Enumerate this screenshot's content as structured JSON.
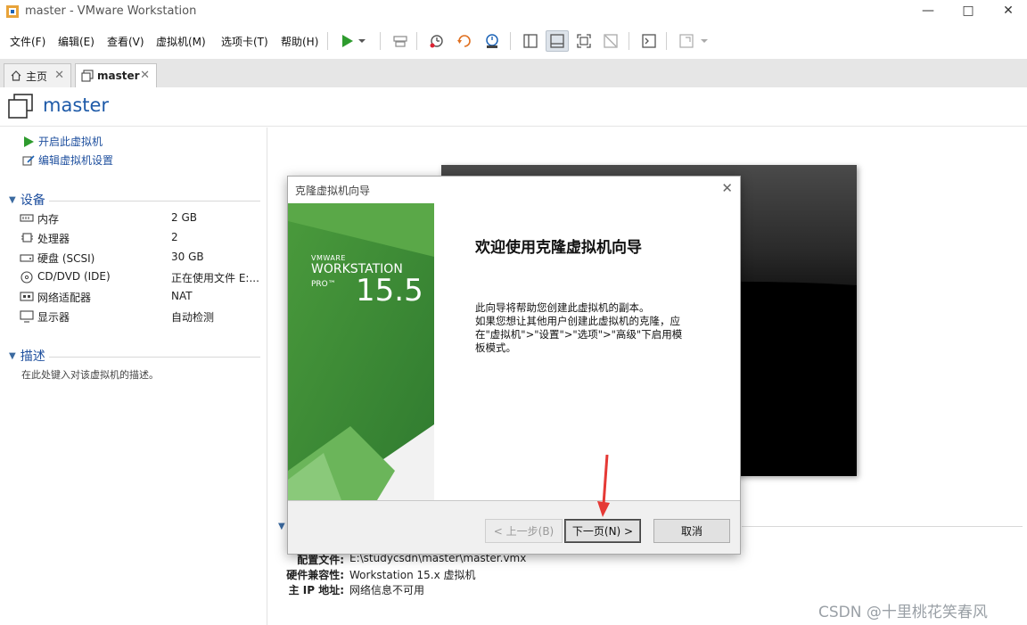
{
  "window": {
    "title": "master - VMware Workstation",
    "minimize_icon": "minimize-icon",
    "maximize_icon": "maximize-icon",
    "close_icon": "close-icon"
  },
  "menu": [
    "文件(F)",
    "编辑(E)",
    "查看(V)",
    "虚拟机(M)",
    "选项卡(T)",
    "帮助(H)"
  ],
  "tabs": [
    {
      "label": "主页",
      "icon": "home-icon"
    },
    {
      "label": "master",
      "icon": "vm-icon"
    }
  ],
  "vm": {
    "name": "master",
    "actions": {
      "power_on": "开启此虚拟机",
      "edit_settings": "编辑虚拟机设置"
    },
    "devices_title": "设备",
    "devices": [
      {
        "name": "内存",
        "value": "2 GB",
        "icon": "memory-icon"
      },
      {
        "name": "处理器",
        "value": "2",
        "icon": "cpu-icon"
      },
      {
        "name": "硬盘 (SCSI)",
        "value": "30 GB",
        "icon": "harddisk-icon"
      },
      {
        "name": "CD/DVD (IDE)",
        "value": "正在使用文件 E:...",
        "icon": "cdrom-icon"
      },
      {
        "name": "网络适配器",
        "value": "NAT",
        "icon": "network-icon"
      },
      {
        "name": "显示器",
        "value": "自动检测",
        "icon": "display-icon"
      }
    ],
    "description_title": "描述",
    "description_placeholder": "在此处键入对该虚拟机的描述。",
    "details": [
      {
        "key": "配置文件:",
        "value": "E:\\studycsdn\\master\\master.vmx"
      },
      {
        "key": "硬件兼容性:",
        "value": "Workstation 15.x 虚拟机"
      },
      {
        "key": "主 IP 地址:",
        "value": "网络信息不可用"
      }
    ]
  },
  "dialog": {
    "title": "克隆虚拟机向导",
    "banner_brand": "VMWARE",
    "banner_product": "WORKSTATION",
    "banner_edition": "PRO™",
    "banner_version": "15.5",
    "heading": "欢迎使用克隆虚拟机向导",
    "body": "此向导将帮助您创建此虚拟机的副本。\n如果您想让其他用户创建此虚拟机的克隆，应在\"虚拟机\">\"设置\">\"选项\">\"高级\"下启用模板模式。",
    "back_button": "< 上一步(B)",
    "next_button": "下一页(N) >",
    "cancel_button": "取消"
  },
  "watermark": "CSDN @十里桃花笑春风",
  "colors": {
    "accent_blue": "#1e5aa8",
    "play_green": "#2e9b2e",
    "banner_green": "#3f8f3a",
    "arrow_red": "#e53935"
  }
}
